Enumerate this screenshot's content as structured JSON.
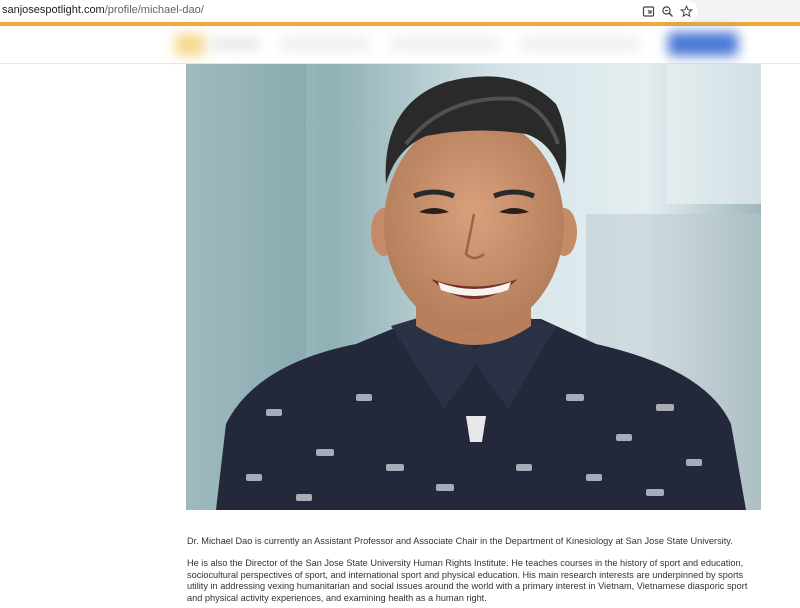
{
  "browser": {
    "url_domain": "sanjosespotlight.com",
    "url_path": "/profile/michael-dao/",
    "icons": [
      "screenshot-icon",
      "zoom-icon",
      "bookmark-star-icon"
    ]
  },
  "colors": {
    "accent": "#f0a93a",
    "shirt": "#23283a",
    "text": "#333333"
  },
  "profile": {
    "photo_alt": "Dr. Michael Dao",
    "bio": [
      "Dr. Michael Dao is currently an Assistant Professor and Associate Chair in the Department of Kinesiology at San Jose State University.",
      "He is also the Director of the San Jose State University Human Rights Institute. He teaches courses in the history of sport and education, sociocultural perspectives of sport, and international sport and physical education. His main research interests are underpinned by sports utility in addressing vexing humanitarian and social issues around the world with a primary interest in Vietnam, Vietnamese diasporic sport and physical activity experiences, and examining health as a human right."
    ]
  }
}
